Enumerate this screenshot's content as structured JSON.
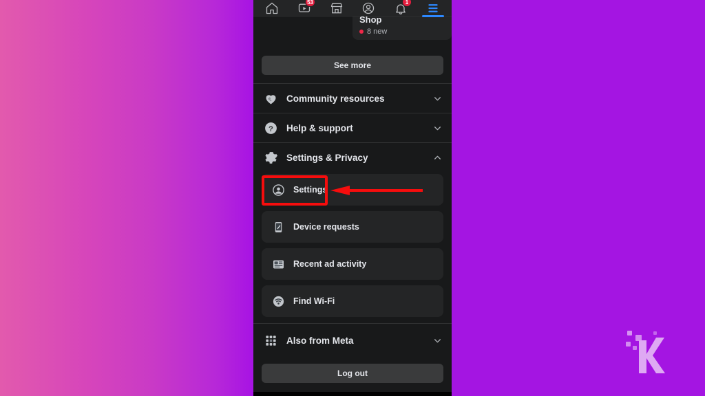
{
  "backdrop": {
    "left_gradient_start": "#e25aad",
    "left_gradient_end": "#a713e4",
    "right_color": "#a415e2"
  },
  "topnav": {
    "items": [
      {
        "icon": "home-icon",
        "label": "Home",
        "badge": ""
      },
      {
        "icon": "video-icon",
        "label": "Video",
        "badge": "53"
      },
      {
        "icon": "marketplace-icon",
        "label": "Marketplace",
        "badge": ""
      },
      {
        "icon": "profile-icon",
        "label": "Profile",
        "badge": ""
      },
      {
        "icon": "bell-icon",
        "label": "Notifications",
        "badge": "1"
      },
      {
        "icon": "hamburger-menu-icon",
        "label": "Menu",
        "badge": ""
      }
    ],
    "active_index": 5,
    "active_color": "#2d88ff"
  },
  "shop_card": {
    "title": "Shop",
    "new_label": "8 new",
    "dot_color": "#f02849"
  },
  "see_more": {
    "label": "See more"
  },
  "sections": [
    {
      "icon": "handshake-heart-icon",
      "label": "Community resources",
      "chevron": "down"
    },
    {
      "icon": "question-circle-icon",
      "label": "Help & support",
      "chevron": "down"
    },
    {
      "icon": "gear-icon",
      "label": "Settings & Privacy",
      "chevron": "up"
    }
  ],
  "settings_items": [
    {
      "icon": "account-circle-icon",
      "label": "Settings"
    },
    {
      "icon": "device-requests-icon",
      "label": "Device requests"
    },
    {
      "icon": "recent-ad-activity-icon",
      "label": "Recent ad activity"
    },
    {
      "icon": "wifi-icon",
      "label": "Find Wi-Fi"
    }
  ],
  "also_from_meta": {
    "icon": "grid-apps-icon",
    "label": "Also from Meta",
    "chevron": "down"
  },
  "logout": {
    "label": "Log out"
  },
  "annotation": {
    "color": "#f60d0d",
    "target": "Settings",
    "shapes": [
      "highlight-rectangle",
      "left-pointing-arrow"
    ]
  },
  "watermark": {
    "letter": "K",
    "color": "#e3b6f5"
  }
}
